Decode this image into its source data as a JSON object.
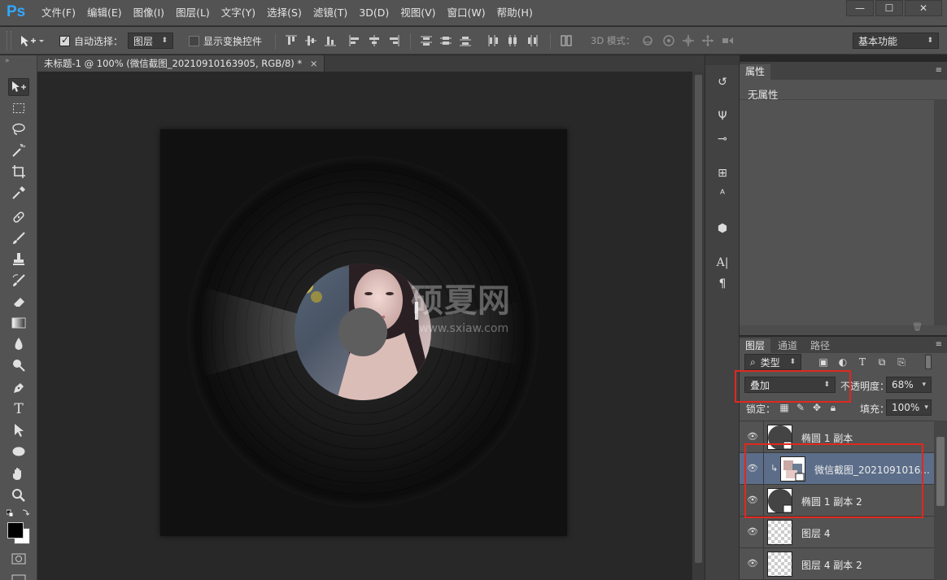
{
  "app": {
    "logo": "Ps"
  },
  "menu": [
    "文件(F)",
    "编辑(E)",
    "图像(I)",
    "图层(L)",
    "文字(Y)",
    "选择(S)",
    "滤镜(T)",
    "3D(D)",
    "视图(V)",
    "窗口(W)",
    "帮助(H)"
  ],
  "window_controls": {
    "minimize": "—",
    "maximize": "☐",
    "close": "✕"
  },
  "options_bar": {
    "auto_select_label": "自动选择：",
    "auto_select_checked": true,
    "auto_select_target": "图层",
    "show_transform_label": "显示变换控件",
    "show_transform_checked": false,
    "mode_3d_label": "3D 模式：",
    "workspace": "基本功能"
  },
  "document_tab": {
    "title": "未标题-1 @ 100% (微信截图_20210910163905, RGB/8) *",
    "close": "×"
  },
  "watermark": {
    "logo_text": "硕夏网",
    "url": "www.sxiaw.com"
  },
  "properties_panel": {
    "tab": "属性",
    "content": "无属性"
  },
  "layers_panel": {
    "tabs": [
      "图层",
      "通道",
      "路径"
    ],
    "filter_type": "类型",
    "blend_mode": "叠加",
    "opacity_label": "不透明度：",
    "opacity_value": "68%",
    "lock_label": "锁定：",
    "fill_label": "填充：",
    "fill_value": "100%",
    "layers": [
      {
        "name": "椭圆 1 副本",
        "thumb": "ellipse",
        "visible": true,
        "selected": false,
        "clipped": false
      },
      {
        "name": "微信截图_2021091016...",
        "thumb": "photo",
        "visible": true,
        "selected": true,
        "clipped": true
      },
      {
        "name": "椭圆 1 副本 2",
        "thumb": "ellipse",
        "visible": true,
        "selected": false,
        "clipped": false
      },
      {
        "name": "图层 4",
        "thumb": "transparent",
        "visible": true,
        "selected": false,
        "clipped": false
      },
      {
        "name": "图层 4 副本 2",
        "thumb": "transparent",
        "visible": true,
        "selected": false,
        "clipped": false
      }
    ]
  },
  "colors": {
    "highlight_red": "#e0281f",
    "selected_layer": "#5b6d89",
    "panel_bg": "#535353"
  }
}
